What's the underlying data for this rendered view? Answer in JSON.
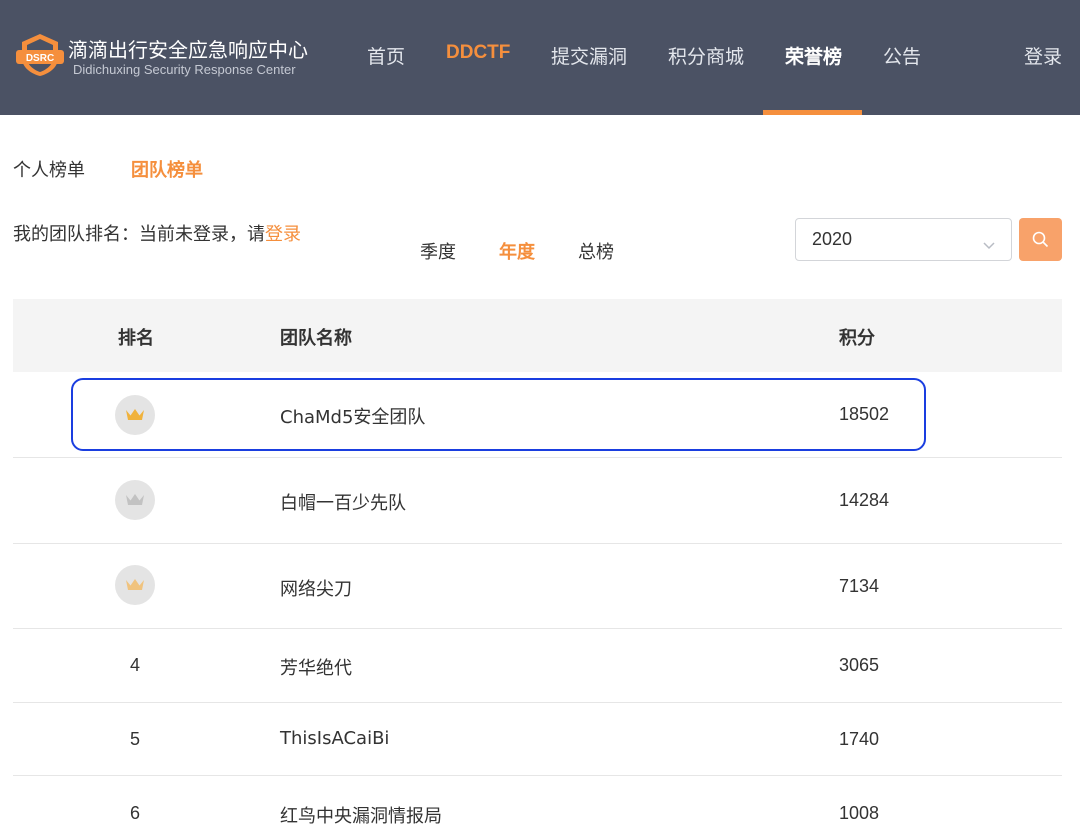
{
  "header": {
    "logo_text": "DSRC",
    "title_cn": "滴滴出行安全应急响应中心",
    "title_en": "Didichuxing Security Response Center",
    "nav": [
      {
        "label": "首页"
      },
      {
        "label": "DDCTF"
      },
      {
        "label": "提交漏洞"
      },
      {
        "label": "积分商城"
      },
      {
        "label": "荣誉榜"
      },
      {
        "label": "公告"
      }
    ],
    "login": "登录"
  },
  "board_tabs": [
    {
      "label": "个人榜单"
    },
    {
      "label": "团队榜单"
    }
  ],
  "my_rank": {
    "prefix": "我的团队排名：当前未登录，请",
    "login_link": "登录"
  },
  "periods": [
    {
      "label": "季度"
    },
    {
      "label": "年度"
    },
    {
      "label": "总榜"
    }
  ],
  "year_select": {
    "value": "2020"
  },
  "table": {
    "headers": {
      "rank": "排名",
      "name": "团队名称",
      "score": "积分"
    },
    "rows": [
      {
        "rank": "",
        "medal": "gold-crown-icon",
        "name": "ChaMd5安全团队",
        "score": "18502"
      },
      {
        "rank": "",
        "medal": "silver-crown-icon",
        "name": "白帽一百少先队",
        "score": "14284"
      },
      {
        "rank": "",
        "medal": "bronze-crown-icon",
        "name": "网络尖刀",
        "score": "7134"
      },
      {
        "rank": "4",
        "medal": "",
        "name": "芳华绝代",
        "score": "3065"
      },
      {
        "rank": "5",
        "medal": "",
        "name": "ThisIsACaiBi",
        "score": "1740"
      },
      {
        "rank": "6",
        "medal": "",
        "name": "红鸟中央漏洞情报局",
        "score": "1008"
      }
    ]
  },
  "colors": {
    "header_bg": "#4b5264",
    "accent": "#f58f3d",
    "gold": "#f0b23c",
    "silver": "#c2c2c2",
    "bronze": "#f0c37e",
    "annotation": "#1a3ee0"
  }
}
